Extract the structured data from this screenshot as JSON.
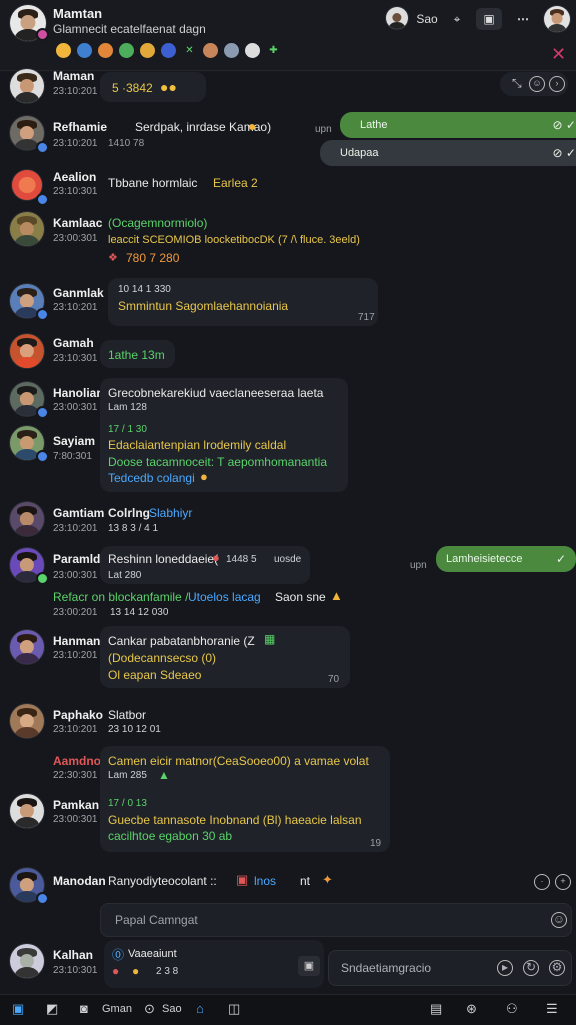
{
  "header": {
    "name": "Mamtan",
    "subtitle": "Glamnecit ecatelfaenat dagn",
    "tool_label": "Sao"
  },
  "replies": [
    {
      "label": "Lathe",
      "color": "#4b8a3e"
    },
    {
      "label": "Udapaa",
      "color": "#34383f"
    },
    {
      "label": "Lamheisietecce",
      "color": "#4b8a3e"
    }
  ],
  "reply_prefix": "upn",
  "messages": [
    {
      "name": "Maman",
      "time": "23:10:201",
      "lines": [
        "5 ·3842"
      ]
    },
    {
      "name": "Refhamie",
      "time": "23:10:201",
      "lines": [
        "Serdpak, inrdase Kamao)",
        "1410 78"
      ]
    },
    {
      "name": "Aealion",
      "time": "23:10:301",
      "lines": [
        "Tbbane hormlaic",
        "Earlea 2"
      ]
    },
    {
      "name": "Kamlaac",
      "time": "23:00:301",
      "lines": [
        "(Ocagemnormiolo)",
        "leaccit SCEOMIOB loocketibocDK (7 /\\ fluce. 3eeld)",
        "780 7 280"
      ]
    },
    {
      "name": "Ganmlak",
      "time": "23:10:201",
      "lines": [
        "10 14 1 330",
        "Smmintun Sagomlaehannoiania",
        "717"
      ]
    },
    {
      "name": "Gamah",
      "time": "23:10:301",
      "lines": [
        "1athe 13m"
      ]
    },
    {
      "name": "Hanolian",
      "time": "23:00:301",
      "lines": [
        "Grecobnekarekiud vaeclaneeseraa laeta",
        "Lam 128"
      ]
    },
    {
      "name": "Sayiam",
      "time": "7:80:301",
      "lines": [
        "17 / 1 30",
        "Edaclaiantenpian lrodemily caldal",
        "Doose tacamnoceit: T aepomhomanantia",
        "Tedcedb colangi"
      ]
    },
    {
      "name": "Gamtiam",
      "time": "23:10:201",
      "lines": [
        "Colrlng",
        "Slabhiyr",
        "13 8 3 / 4 1"
      ]
    },
    {
      "name": "Paramld",
      "time": "23:00:301",
      "lines": [
        "Reshinn loneddaeie(",
        "1448 5",
        "uosde",
        "Lat 280"
      ]
    },
    {
      "name": "",
      "time": "23:00:201",
      "lines": [
        "Refacr on blockanfamile /",
        "Utoelos lacag",
        "Saon sne",
        "13 14 12 030"
      ]
    },
    {
      "name": "Hanman",
      "time": "23:10:201",
      "lines": [
        "Cankar pabatanbhoranie (Z",
        "(Dodecannsecso (0)",
        "Ol eapan Sdeaeo",
        "70"
      ]
    },
    {
      "name": "Paphako",
      "time": "23:10:201",
      "lines": [
        "Slatbor",
        "23 10 12 01"
      ]
    },
    {
      "name": "Aamdnoe",
      "time": "22:30:301",
      "lines": [
        "Camen eicir matnor(CeaSooeo00) a vamae volat",
        "Lam 285"
      ]
    },
    {
      "name": "Pamkan",
      "time": "23:00:301",
      "lines": [
        "17 / 0 13",
        "Guecbe tannasote Inobnand (Bl) haeacie lalsan",
        "cacilhtoe egabon 30 ab",
        "19"
      ]
    },
    {
      "name": "Manodan",
      "time": "23:00:201",
      "lines": [
        "Ranyodiyteocolant ::",
        "lnos",
        "nt"
      ]
    },
    {
      "name": "Kalhan",
      "time": "23:10:301",
      "lines": [
        "Vaaeaiunt",
        "2 3 8"
      ]
    }
  ],
  "composer_placeholder": "Papal Camngat",
  "input2_placeholder": "Sndaetiamgracio",
  "footer": {
    "label1": "Gman",
    "label2": "Sao"
  },
  "colors": {
    "reply_green": "#4b8a3e",
    "accent_blue": "#4aa8ff",
    "accent_green": "#5ad36a",
    "accent_yellow": "#e8c74b",
    "close_pink": "#d13a6a"
  }
}
